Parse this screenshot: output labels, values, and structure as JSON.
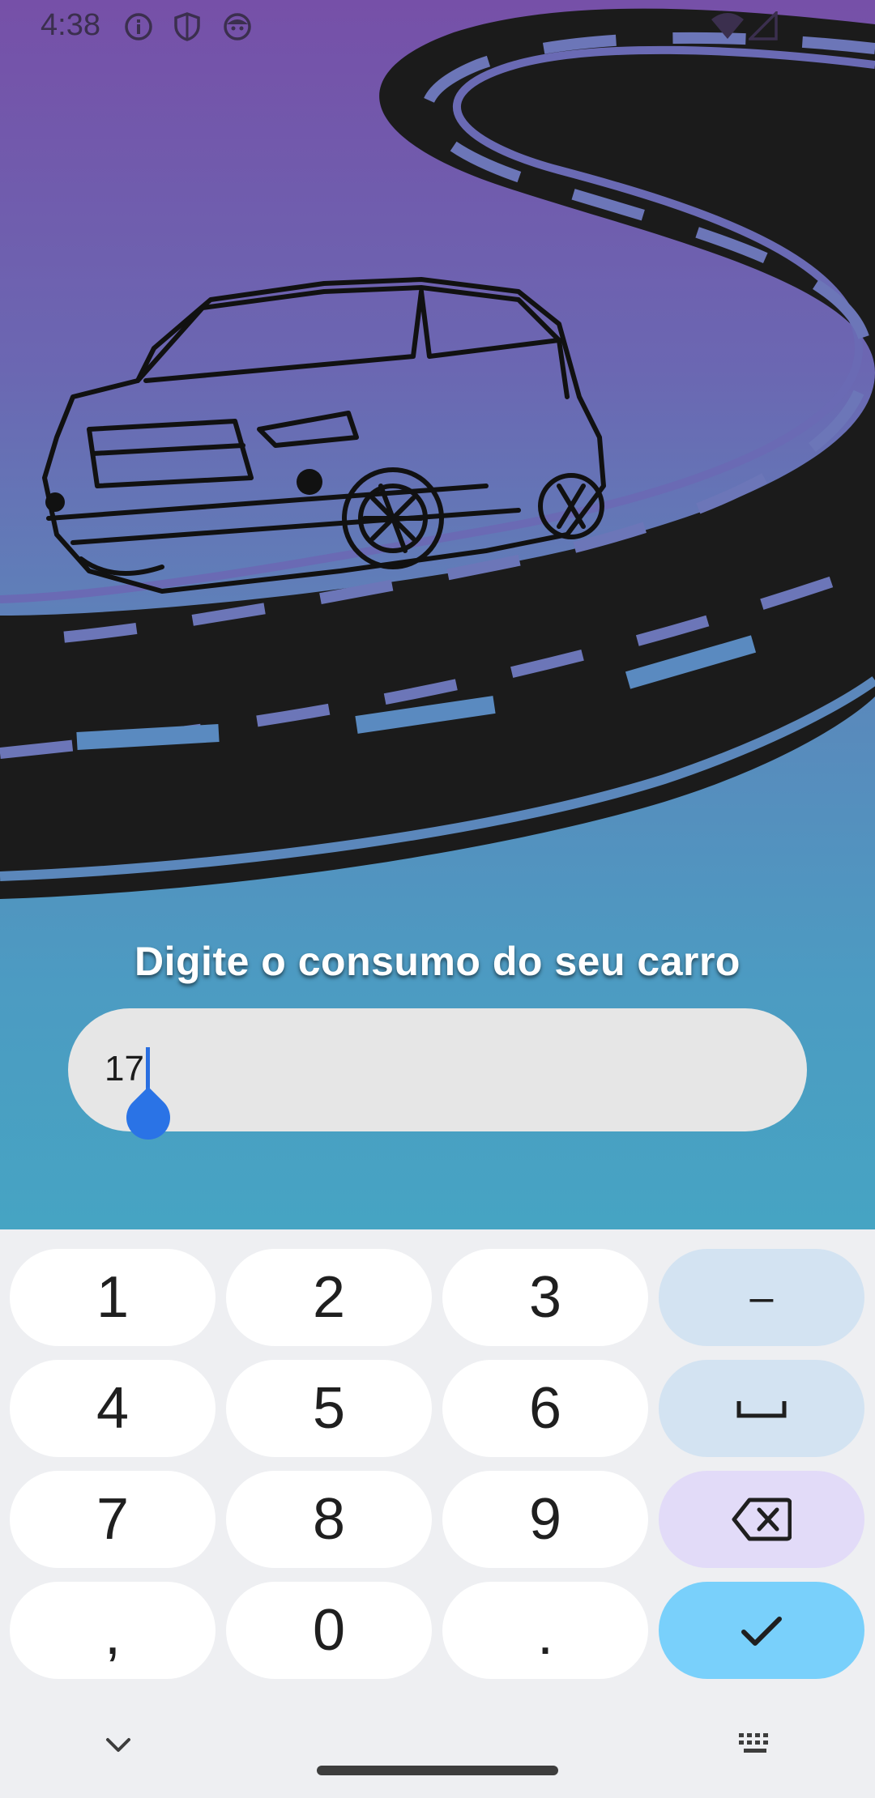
{
  "status_bar": {
    "time": "4:38",
    "icons": [
      "info-icon",
      "shield-icon",
      "face-icon",
      "wifi-icon",
      "signal-icon"
    ]
  },
  "screen": {
    "title": "Digite o consumo do seu carro",
    "input_value": "17"
  },
  "keyboard": {
    "keys": {
      "k1": "1",
      "k2": "2",
      "k3": "3",
      "minus": "–",
      "k4": "4",
      "k5": "5",
      "k6": "6",
      "k7": "7",
      "k8": "8",
      "k9": "9",
      "comma": ",",
      "k0": "0",
      "period": "."
    }
  },
  "colors": {
    "gradient_top": "#7650a8",
    "gradient_bottom": "#46a4c3",
    "road": "#1b1b1b",
    "caret": "#2a6fe0",
    "enter_key": "#79d0fb",
    "delete_key": "#e2dbf8",
    "function_key": "#d3e3f2"
  }
}
